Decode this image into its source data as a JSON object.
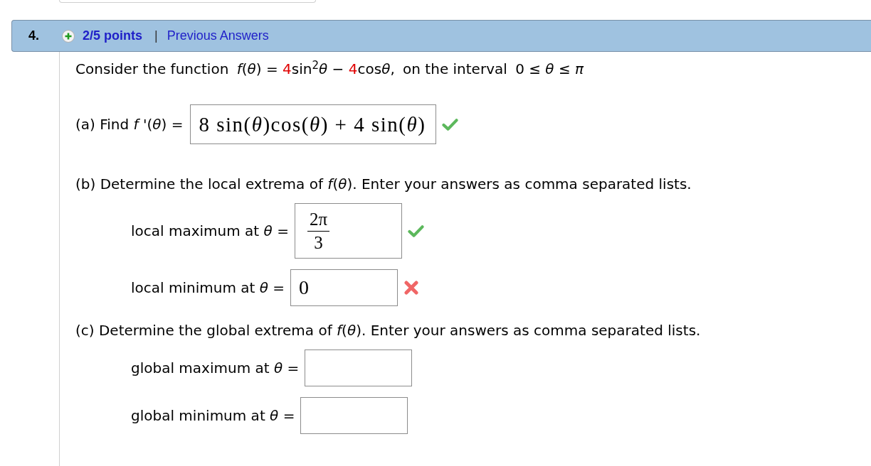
{
  "question": {
    "number": "4.",
    "points": "2/5 points",
    "separator": "|",
    "link": "Previous Answers",
    "prompt": [
      {
        "kind": "text",
        "text": "Consider the function "
      },
      {
        "kind": "math",
        "text": "*f*(*θ*) = "
      },
      {
        "kind": "highlight",
        "text": "4"
      },
      {
        "kind": "math",
        "text": "sin$^{2}$*θ* − "
      },
      {
        "kind": "highlight",
        "text": "4"
      },
      {
        "kind": "math",
        "text": "cos"
      },
      {
        "kind": "math",
        "text": "*θ*, "
      },
      {
        "kind": "text",
        "text": "on the interval "
      },
      {
        "kind": "math",
        "text": "0 ≤ *θ* ≤ *π*"
      }
    ]
  },
  "parts": [
    {
      "kind": "inline",
      "label": "(a) Find *f* '(*θ*) =",
      "answer": {
        "kind": "expression",
        "value": "8 sin(*θ*)cos(*θ*) + 4 sin(*θ*)"
      },
      "correct": true
    },
    {
      "kind": "group",
      "text": "(b) Determine the local extrema of *f*(*θ*). Enter your answers as comma separated lists.",
      "rows": [
        {
          "label": "local maximum at *θ* =",
          "answer": {
            "kind": "fraction",
            "numerator": "2π",
            "denominator": "3"
          },
          "correct": true
        },
        {
          "label": "local minimum at *θ* =",
          "answer": {
            "kind": "expression",
            "value": "0"
          },
          "correct": false
        }
      ]
    },
    {
      "kind": "group",
      "text": "(c) Determine the global extrema of *f*(*θ*). Enter your answers as comma separated lists.",
      "rows": [
        {
          "label": "global maximum at *θ* ="
        },
        {
          "label": "global minimum at *θ* ="
        }
      ]
    }
  ]
}
